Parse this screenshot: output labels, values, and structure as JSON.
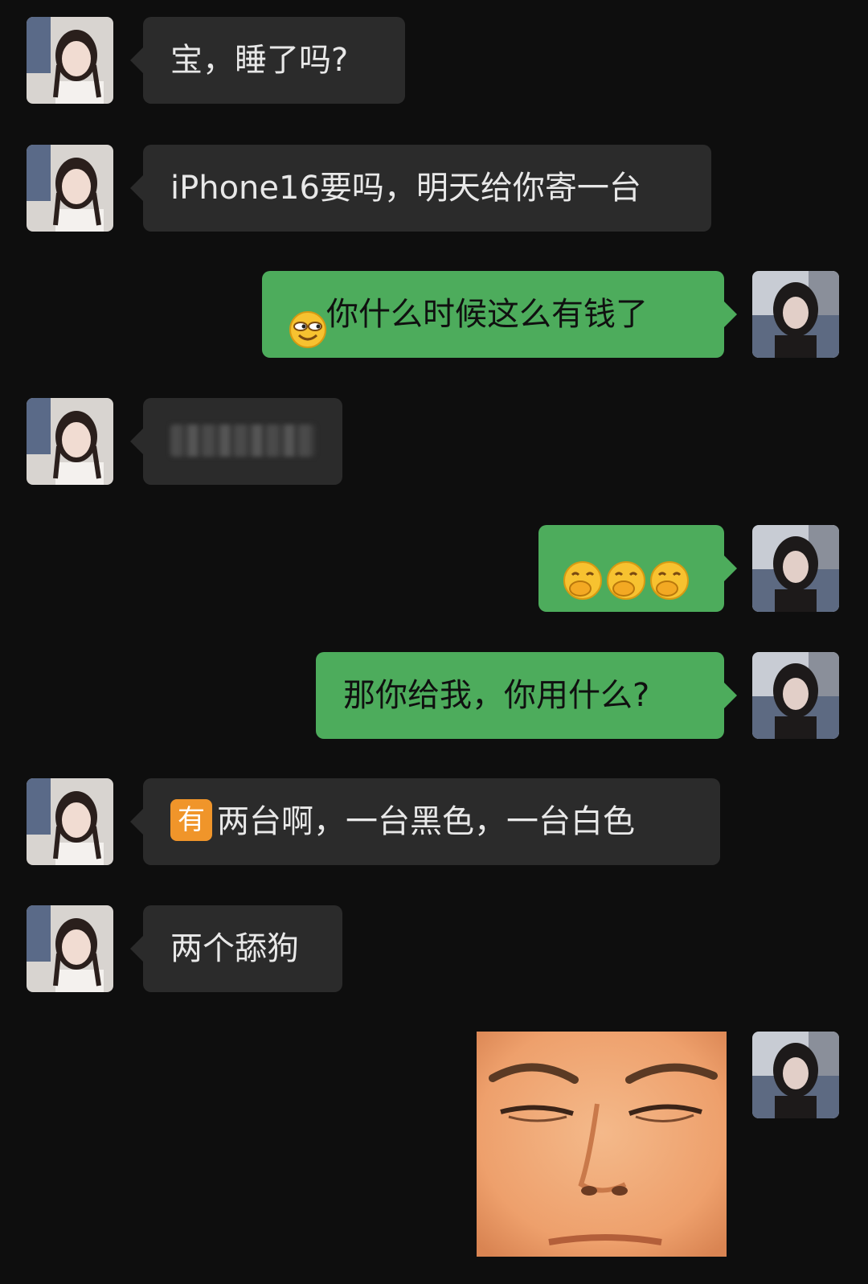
{
  "messages": [
    {
      "side": "in",
      "text": "宝，睡了吗?"
    },
    {
      "side": "in",
      "text": "iPhone16要吗，明天给你寄一台"
    },
    {
      "side": "out",
      "emoji": "smirk-face-emoji",
      "text": "你什么时候这么有钱了"
    },
    {
      "side": "in",
      "text": "",
      "blurred": true
    },
    {
      "side": "out",
      "emoji": "hand-over-mouth-emoji x3",
      "text": ""
    },
    {
      "side": "out",
      "text": "那你给我，你用什么?"
    },
    {
      "side": "in",
      "badge": "有",
      "text": "两台啊，一台黑色，一台白色"
    },
    {
      "side": "in",
      "text": "两个舔狗"
    },
    {
      "side": "out",
      "sticker": "face-closeup-sticker"
    }
  ],
  "colors": {
    "background": "#0e0e0e",
    "incoming_bubble": "#2b2b2b",
    "outgoing_bubble": "#4dac5c",
    "badge": "#f0952a"
  }
}
